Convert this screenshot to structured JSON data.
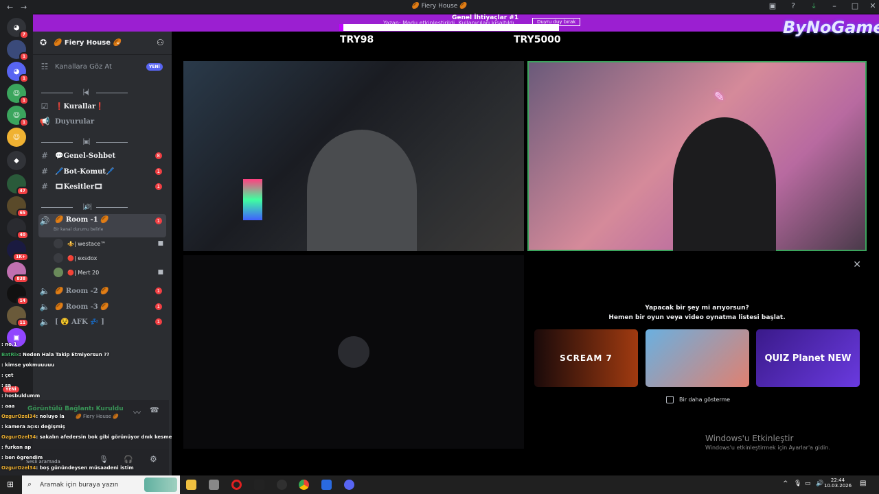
{
  "window": {
    "title": "🏉 Fiery House 🏉",
    "back": "←",
    "forward": "→"
  },
  "banner": {
    "title": "Genel İhtiyaçlar #1",
    "subtitle": "Yazan: Modu etkinleştirildi. Kullanıcıları kısaltıldı",
    "button": "Duyru duy bırak",
    "progress": 0.02
  },
  "overlay": {
    "amount_left": "TRY98",
    "amount_right": "TRY5000",
    "logo": "ByNoGame"
  },
  "server": {
    "name": "🏉 Fiery House 🏉"
  },
  "browse_channels": {
    "label": "Kanallara Göz At",
    "badge": "YENİ"
  },
  "channels": [
    {
      "label": "❗Kurallar❗",
      "icon": "rules-icon"
    },
    {
      "label": "Duyurular",
      "icon": "megaphone-icon"
    },
    {
      "label": "💬Genel-Sohbet",
      "count": "8"
    },
    {
      "label": "🖊️Bot-Komut🖊️",
      "count": "1"
    },
    {
      "label": "🎞Kesitler🎞",
      "count": "1"
    }
  ],
  "voice_active": {
    "label": "🏉 Room -1 🏉",
    "status": "Bir kanal durumu belirle",
    "count": "1"
  },
  "voice_members": [
    "⚜️| westace™",
    "🔴| exsdox",
    "🔴| Mert 20"
  ],
  "voice_others": [
    {
      "label": "🏉 Room -2 🏉",
      "count": "1"
    },
    {
      "label": "🏉 Room -3 🏉",
      "count": "1"
    },
    {
      "label": "[ 😵 AFK 💤 ]",
      "count": "1"
    }
  ],
  "guild_badges": [
    "7",
    "1",
    "1",
    "1",
    "1",
    "47",
    "65",
    "40",
    "1K+",
    "838",
    "14",
    "11"
  ],
  "chat": [
    {
      "user": "",
      "msg": ": no.1"
    },
    {
      "user": "BatRix",
      "msg": ": Neden Hala Takip Etmiyorsun ??"
    },
    {
      "user": "",
      "msg": ": kimse yokmuuuuu"
    },
    {
      "user": "",
      "msg": ": çet"
    },
    {
      "user": "",
      "msg": ": sa"
    },
    {
      "user": "",
      "msg": ": hosbuldumm"
    },
    {
      "user": "",
      "msg": ": aaa"
    },
    {
      "user": "OzgurOzel34",
      "msg": ": noluyo la"
    },
    {
      "user": "",
      "msg": ": kamera açısı değişmiş"
    },
    {
      "user": "OzgurOzel34",
      "msg": ": sakalın afedersin bok gibi görünüyor dnık kesme bida"
    },
    {
      "user": "",
      "msg": ": furkan ap"
    },
    {
      "user": "",
      "msg": ": ben ögrendim"
    },
    {
      "user": "OzgurOzel34",
      "msg": ": boş günündeysen müsaadeni istim"
    }
  ],
  "voice_status": {
    "label": "Görüntülü Bağlantı Kuruldu",
    "server": "🏉 Fiery House 🏉",
    "bubble": "Sesli aramada",
    "new": "YENİ"
  },
  "activity": {
    "line1": "Yapacak bir şey mi arıyorsun?",
    "line2": "Hemen bir oyun veya video oynatma listesi başlat.",
    "games": [
      "SCREAM 7",
      "",
      "QUIZ Planet NEW"
    ],
    "dont_show": "Bir daha gösterme"
  },
  "windows": {
    "activate": "Windows'u Etkinleştir",
    "activate_sub": "Windows'u etkinleştirmek için Ayarlar'a gidin."
  },
  "taskbar": {
    "search_placeholder": "Aramak için buraya yazın",
    "time": "22:44",
    "date": "10.03.2026"
  }
}
